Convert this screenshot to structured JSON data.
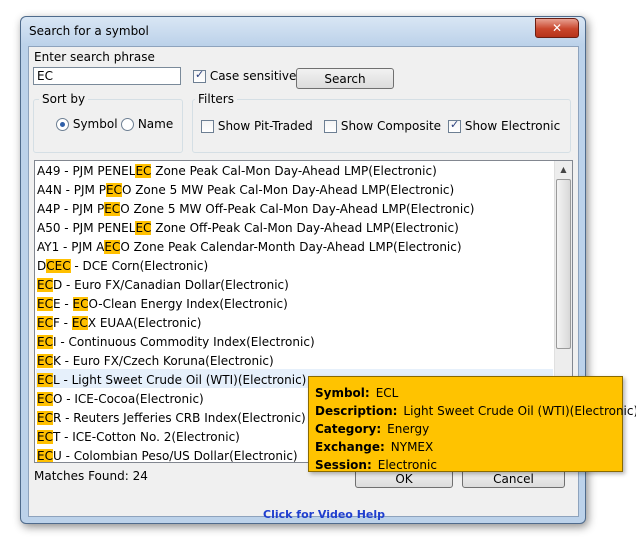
{
  "window": {
    "title": "Search for a symbol",
    "close_glyph": "✕"
  },
  "search": {
    "label": "Enter search phrase",
    "value": "EC",
    "case_sensitive_label": "Case sensitive",
    "case_sensitive_checked": true,
    "button": "Search"
  },
  "sort": {
    "title": "Sort by",
    "options": [
      {
        "label": "Symbol",
        "selected": true
      },
      {
        "label": "Name",
        "selected": false
      }
    ]
  },
  "filters": {
    "title": "Filters",
    "items": [
      {
        "label": "Show Pit-Traded",
        "checked": false
      },
      {
        "label": "Show Composite",
        "checked": false
      },
      {
        "label": "Show Electronic",
        "checked": true
      }
    ]
  },
  "results": [
    {
      "pre": "A49 - PJM PENEL",
      "hl1": "EC",
      "mid": " Zone Peak Cal-Mon Day-Ahead LMP(Electronic)",
      "hl2": "",
      "post": ""
    },
    {
      "pre": "A4N - PJM P",
      "hl1": "EC",
      "mid": "O Zone 5 MW Peak Cal-Mon Day-Ahead LMP(Electronic)",
      "hl2": "",
      "post": ""
    },
    {
      "pre": "A4P - PJM P",
      "hl1": "EC",
      "mid": "O Zone 5 MW Off-Peak Cal-Mon Day-Ahead LMP(Electronic)",
      "hl2": "",
      "post": ""
    },
    {
      "pre": "A50 - PJM PENEL",
      "hl1": "EC",
      "mid": " Zone Off-Peak Cal-Mon Day-Ahead LMP(Electronic)",
      "hl2": "",
      "post": ""
    },
    {
      "pre": "AY1 - PJM A",
      "hl1": "EC",
      "mid": "O Zone Peak Calendar-Month Day-Ahead LMP(Electronic)",
      "hl2": "",
      "post": ""
    },
    {
      "pre": "D",
      "hl1": "CEC",
      "mid": " - DCE Corn(Electronic)",
      "hl2": "",
      "post": ""
    },
    {
      "pre": "",
      "hl1": "EC",
      "mid": "D - Euro FX/Canadian Dollar(Electronic)",
      "hl2": "",
      "post": ""
    },
    {
      "pre": "",
      "hl1": "EC",
      "mid": "E - ",
      "hl2": "EC",
      "post": "O-Clean Energy Index(Electronic)"
    },
    {
      "pre": "",
      "hl1": "EC",
      "mid": "F - ",
      "hl2": "EC",
      "post": "X EUAA(Electronic)"
    },
    {
      "pre": "",
      "hl1": "EC",
      "mid": "I - Continuous Commodity Index(Electronic)",
      "hl2": "",
      "post": ""
    },
    {
      "pre": "",
      "hl1": "EC",
      "mid": "K - Euro FX/Czech Koruna(Electronic)",
      "hl2": "",
      "post": ""
    },
    {
      "pre": "",
      "hl1": "EC",
      "mid": "L - Light Sweet Crude Oil (WTI)(Electronic)",
      "hl2": "",
      "post": ""
    },
    {
      "pre": "",
      "hl1": "EC",
      "mid": "O - ICE-Cocoa(Electronic)",
      "hl2": "",
      "post": ""
    },
    {
      "pre": "",
      "hl1": "EC",
      "mid": "R - Reuters Jefferies CRB Index(Electronic)",
      "hl2": "",
      "post": ""
    },
    {
      "pre": "",
      "hl1": "EC",
      "mid": "T - ICE-Cotton No. 2(Electronic)",
      "hl2": "",
      "post": ""
    },
    {
      "pre": "",
      "hl1": "EC",
      "mid": "U - Colombian Peso/US Dollar(Electronic)",
      "hl2": "",
      "post": ""
    }
  ],
  "matches_text": "Matches Found: 24",
  "ok_label": "OK",
  "cancel_label": "Cancel",
  "video_help": "Click for Video Help",
  "tooltip": {
    "symbol_label": "Symbol:",
    "symbol": "ECL",
    "description_label": "Description:",
    "description": "Light Sweet Crude Oil (WTI)(Electronic)",
    "category_label": "Category:",
    "category": "Energy",
    "exchange_label": "Exchange:",
    "exchange": "NYMEX",
    "session_label": "Session:",
    "session": "Electronic"
  },
  "colors": {
    "highlight": "#ffc000",
    "tooltip_bg": "#ffc300",
    "link": "#1f3fcf"
  }
}
